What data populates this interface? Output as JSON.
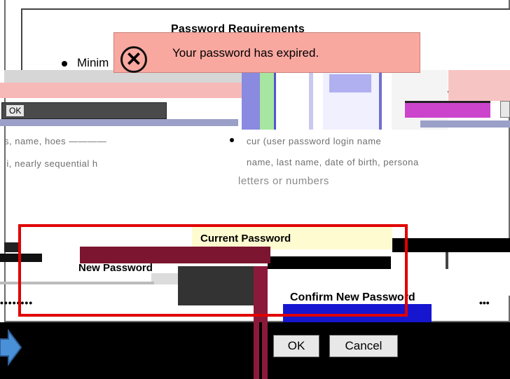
{
  "requirements": {
    "title": "Password Requirements",
    "item_min": "Minim",
    "scrambled_left": "s, name, hoes ————",
    "scrambled_left2": "li, nearly sequential h",
    "scrambled_right": "cur (user password login name",
    "scrambled_right2": "name, last name, date of birth, persona",
    "scrambled_right3": "letters or numbers"
  },
  "alert": {
    "message": "Your password has expired.",
    "icon": "close-circle-icon",
    "background_color": "#f9a8a0"
  },
  "small_dialog": {
    "ok_label": "OK"
  },
  "form": {
    "current_password_label": "Current Password",
    "new_password_label": "New Password",
    "confirm_password_label": "Confirm New Password",
    "masked_value": "••••••••",
    "masked_value_right": "•••",
    "highlight_color": "#e00000"
  },
  "buttons": {
    "ok_label": "OK",
    "cancel_label": "Cancel"
  },
  "arrow": {
    "icon": "right-arrow-icon",
    "color": "#4a90d9"
  }
}
